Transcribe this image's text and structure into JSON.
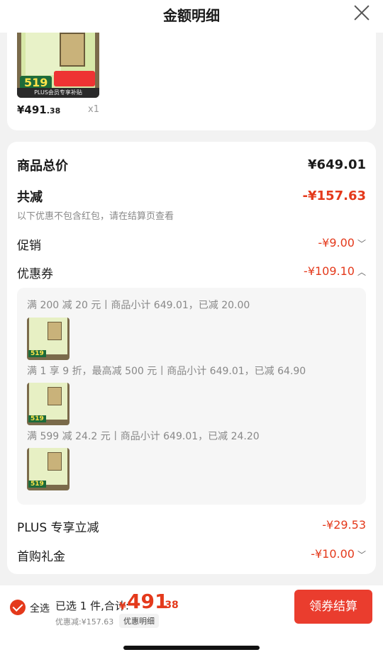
{
  "header": {
    "title": "金额明细"
  },
  "product": {
    "thumb_price": "519",
    "thumb_caption": "PLUS会员专享补贴",
    "price_int": "¥491",
    "price_dec": ".38",
    "qty": "x1"
  },
  "summary": {
    "total_label": "商品总价",
    "total_value": "¥649.01",
    "save_label": "共减",
    "save_value": "-¥157.63",
    "save_note": "以下优惠不包含红包，请在结算页查看",
    "promo_label": "促销",
    "promo_value": "-¥9.00",
    "coupon_label": "优惠券",
    "coupon_value": "-¥109.10",
    "plus_label": "PLUS 专享立减",
    "plus_value": "-¥29.53",
    "first_label": "首购礼金",
    "first_value": "-¥10.00"
  },
  "coupons": [
    {
      "text": "满 200 减 20 元丨商品小计 649.01，已减 20.00",
      "thumb_price": "519"
    },
    {
      "text": "满 1 享 9 折，最高减 500 元丨商品小计 649.01，已减 64.90",
      "thumb_price": "519"
    },
    {
      "text": "满 599 减 24.2 元丨商品小计 649.01，已减 24.20",
      "thumb_price": "519"
    }
  ],
  "bottom": {
    "select_all": "全选",
    "selected": "已选 1 件,合计:",
    "currency": "¥",
    "total_int": "491",
    "total_dec": ".38",
    "discount": "优惠减:¥157.63",
    "detail": "优惠明细",
    "checkout": "领券结算"
  },
  "colors": {
    "accent": "#e4391b",
    "checkout": "#ea3d2e"
  },
  "icons": {
    "close": "close-icon",
    "check": "check-icon",
    "chevron": "chevron-icon"
  }
}
